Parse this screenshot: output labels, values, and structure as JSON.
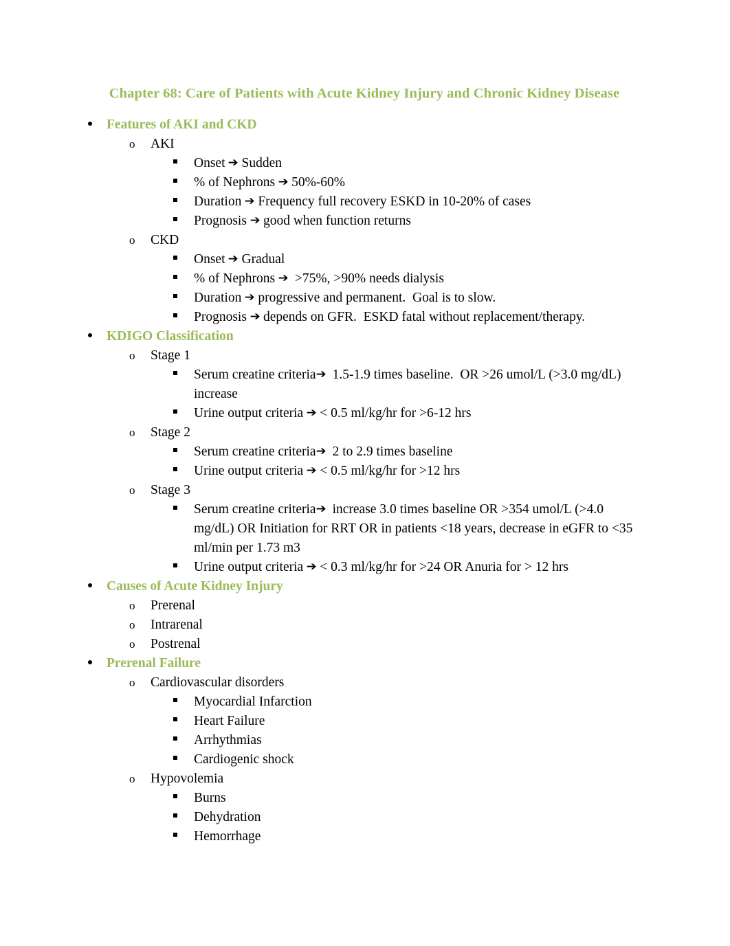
{
  "document": {
    "title": "Chapter 68: Care of Patients with Acute Kidney Injury and Chronic Kidney Disease",
    "heading_color": "#9BBB59",
    "body_color": "#000000",
    "background_color": "#FFFFFF",
    "arrow_glyph": "➔"
  },
  "outline": [
    {
      "level": 1,
      "bullet": "round-bullet",
      "text": "Features of AKI and CKD"
    },
    {
      "level": 2,
      "bullet": "o-bullet",
      "text": "AKI"
    },
    {
      "level": 3,
      "bullet": "square-bullet",
      "pre": "Onset ",
      "arrow": true,
      "post": " Sudden"
    },
    {
      "level": 3,
      "bullet": "square-bullet",
      "pre": "% of Nephrons ",
      "arrow": true,
      "post": " 50%-60%"
    },
    {
      "level": 3,
      "bullet": "square-bullet",
      "pre": "Duration ",
      "arrow": true,
      "post": " Frequency full recovery ESKD in 10-20% of cases"
    },
    {
      "level": 3,
      "bullet": "square-bullet",
      "pre": "Prognosis ",
      "arrow": true,
      "post": " good when function returns"
    },
    {
      "level": 2,
      "bullet": "o-bullet",
      "text": "CKD"
    },
    {
      "level": 3,
      "bullet": "square-bullet",
      "pre": "Onset ",
      "arrow": true,
      "post": " Gradual"
    },
    {
      "level": 3,
      "bullet": "square-bullet",
      "pre": "% of Nephrons ",
      "arrow": true,
      "post": "  >75%, >90% needs dialysis"
    },
    {
      "level": 3,
      "bullet": "square-bullet",
      "pre": "Duration ",
      "arrow": true,
      "post": " progressive and permanent.  Goal is to slow."
    },
    {
      "level": 3,
      "bullet": "square-bullet",
      "pre": "Prognosis ",
      "arrow": true,
      "post": " depends on GFR.  ESKD fatal without replacement/therapy."
    },
    {
      "level": 1,
      "bullet": "round-bullet",
      "text": "KDIGO Classification"
    },
    {
      "level": 2,
      "bullet": "o-bullet",
      "text": "Stage 1"
    },
    {
      "level": 3,
      "bullet": "square-bullet",
      "pre": "Serum creatine criteria",
      "arrow": true,
      "post": "  1.5-1.9 times baseline.  OR >26 umol/L (>3.0 mg/dL) increase"
    },
    {
      "level": 3,
      "bullet": "square-bullet",
      "pre": "Urine output criteria ",
      "arrow": true,
      "post": " < 0.5 ml/kg/hr for >6-12 hrs"
    },
    {
      "level": 2,
      "bullet": "o-bullet",
      "text": "Stage 2"
    },
    {
      "level": 3,
      "bullet": "square-bullet",
      "pre": "Serum creatine criteria",
      "arrow": true,
      "post": "  2 to 2.9 times baseline"
    },
    {
      "level": 3,
      "bullet": "square-bullet",
      "pre": "Urine output criteria ",
      "arrow": true,
      "post": " < 0.5 ml/kg/hr for >12 hrs"
    },
    {
      "level": 2,
      "bullet": "o-bullet",
      "text": "Stage 3"
    },
    {
      "level": 3,
      "bullet": "square-bullet",
      "pre": "Serum creatine criteria",
      "arrow": true,
      "post": "  increase 3.0 times baseline OR >354 umol/L (>4.0 mg/dL) OR Initiation for RRT OR in patients <18 years, decrease in eGFR to <35 ml/min per 1.73 m3"
    },
    {
      "level": 3,
      "bullet": "square-bullet",
      "pre": "Urine output criteria ",
      "arrow": true,
      "post": " < 0.3 ml/kg/hr for >24 OR Anuria for > 12 hrs"
    },
    {
      "level": 1,
      "bullet": "round-bullet",
      "text": "Causes of Acute Kidney Injury"
    },
    {
      "level": 2,
      "bullet": "o-bullet",
      "text": "Prerenal"
    },
    {
      "level": 2,
      "bullet": "o-bullet",
      "text": "Intrarenal"
    },
    {
      "level": 2,
      "bullet": "o-bullet",
      "text": "Postrenal"
    },
    {
      "level": 1,
      "bullet": "round-bullet",
      "text": "Prerenal Failure"
    },
    {
      "level": 2,
      "bullet": "o-bullet",
      "text": "Cardiovascular disorders"
    },
    {
      "level": 3,
      "bullet": "square-bullet",
      "text": "Myocardial Infarction"
    },
    {
      "level": 3,
      "bullet": "square-bullet",
      "text": "Heart Failure"
    },
    {
      "level": 3,
      "bullet": "square-bullet",
      "text": "Arrhythmias"
    },
    {
      "level": 3,
      "bullet": "square-bullet",
      "text": "Cardiogenic shock"
    },
    {
      "level": 2,
      "bullet": "o-bullet",
      "text": "Hypovolemia"
    },
    {
      "level": 3,
      "bullet": "square-bullet",
      "text": "Burns"
    },
    {
      "level": 3,
      "bullet": "square-bullet",
      "text": "Dehydration"
    },
    {
      "level": 3,
      "bullet": "square-bullet",
      "text": "Hemorrhage"
    }
  ]
}
